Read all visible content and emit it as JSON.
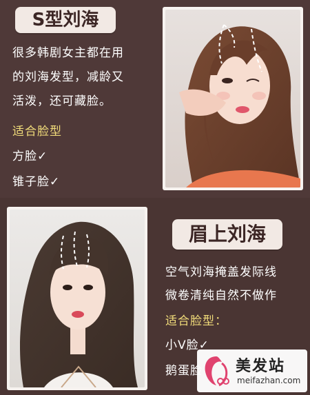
{
  "top": {
    "title": "S型刘海",
    "lines": [
      "很多韩剧女主都在用",
      "的刘海发型，减龄又",
      "活泼，还可藏脸。"
    ],
    "face_label": "适合脸型",
    "faces": [
      "方脸✓",
      "锥子脸✓"
    ]
  },
  "bottom": {
    "title": "眉上刘海",
    "lines": [
      "空气刘海掩盖发际线",
      "微卷清纯自然不做作"
    ],
    "face_label": "适合脸型：",
    "faces": [
      "小V脸✓",
      "鹅蛋脸"
    ]
  },
  "watermark": {
    "brand": "美发站",
    "url": "meifazhan.com"
  },
  "colors": {
    "background": "#4e3837",
    "title_badge": "#f2e9e4",
    "face_label": "#f1dc7a",
    "logo_pink": "#e0436f"
  }
}
